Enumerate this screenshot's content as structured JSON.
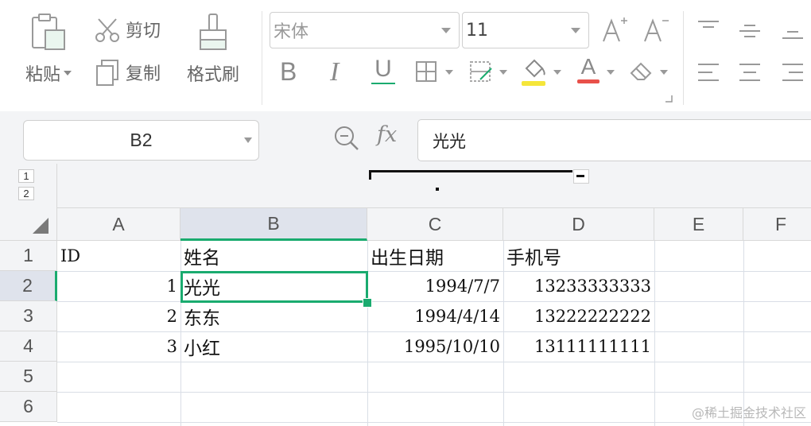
{
  "toolbar": {
    "paste_label": "粘贴",
    "cut_label": "剪切",
    "copy_label": "复制",
    "format_painter_label": "格式刷",
    "font_name": "宋体",
    "font_size": "11",
    "bold_glyph": "B",
    "italic_glyph": "I",
    "underline_glyph": "U",
    "font_color_glyph": "A"
  },
  "formula_bar": {
    "name_box": "B2",
    "fx_label": "fx",
    "content": "光光"
  },
  "outline_levels": [
    "1",
    "2"
  ],
  "columns": [
    "A",
    "B",
    "C",
    "D",
    "E",
    "F"
  ],
  "selected_column": "B",
  "rows": [
    "1",
    "2",
    "3",
    "4",
    "5",
    "6"
  ],
  "selected_row": "2",
  "cells": {
    "r1": {
      "A": "ID",
      "B": "姓名",
      "C": "出生日期",
      "D": "手机号"
    },
    "r2": {
      "A": "1",
      "B": "光光",
      "C": "1994/7/7",
      "D": "13233333333"
    },
    "r3": {
      "A": "2",
      "B": "东东",
      "C": "1994/4/14",
      "D": "13222222222"
    },
    "r4": {
      "A": "3",
      "B": "小红",
      "C": "1995/10/10",
      "D": "13111111111"
    }
  },
  "watermark": "@稀土掘金技术社区",
  "colors": {
    "accent": "#1aab6f",
    "header_bg": "#f3f4f6",
    "selected_header_bg": "#dfe3ec",
    "highlight_yellow": "#f5e63a",
    "font_color_red": "#e8504a"
  }
}
